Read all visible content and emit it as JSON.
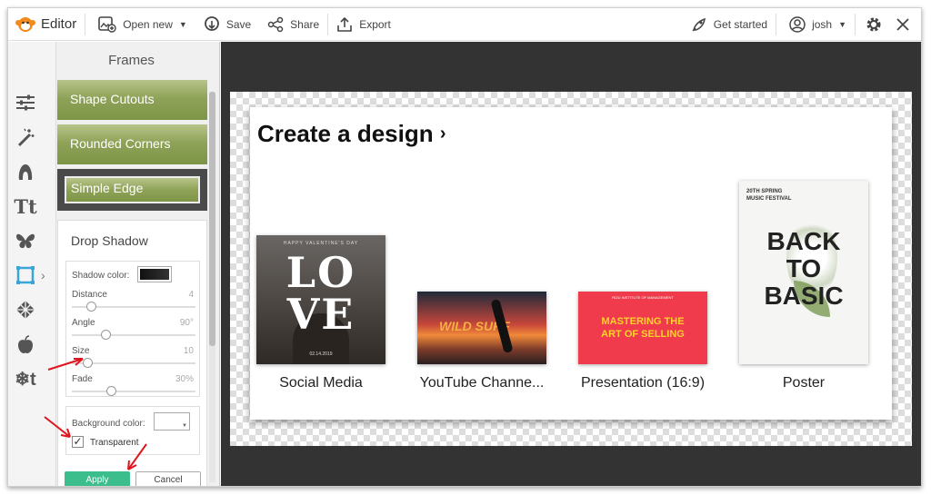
{
  "topbar": {
    "app_name": "Editor",
    "open_new": "Open new",
    "save": "Save",
    "share": "Share",
    "export": "Export",
    "get_started": "Get started",
    "user": "josh"
  },
  "rail": {
    "icons": [
      "adjustments-icon",
      "magic-wand-icon",
      "touch-up-icon",
      "text-icon",
      "butterfly-icon",
      "frame-icon",
      "texture-icon",
      "apple-icon",
      "seasonal-icon"
    ],
    "active": "frame-icon"
  },
  "panel": {
    "title": "Frames",
    "frames": [
      "Shape Cutouts",
      "Rounded Corners",
      "Simple Edge"
    ],
    "drop_shadow": {
      "title": "Drop Shadow",
      "shadow_color_label": "Shadow color:",
      "sliders": [
        {
          "label": "Distance",
          "value": "4"
        },
        {
          "label": "Angle",
          "value": "90°"
        },
        {
          "label": "Size",
          "value": "10"
        },
        {
          "label": "Fade",
          "value": "30%"
        }
      ],
      "background_color_label": "Background color:",
      "transparent_label": "Transparent",
      "transparent_checked": true,
      "apply": "Apply",
      "cancel": "Cancel"
    }
  },
  "canvas": {
    "heading": "Create a design",
    "designs": [
      {
        "label": "Social Media",
        "thumb_text": [
          "LOVE",
          "HAPPY VALENTINE'S DAY",
          "02.14.2019"
        ]
      },
      {
        "label": "YouTube Channe...",
        "thumb_text": [
          "WILD SURF"
        ]
      },
      {
        "label": "Presentation (16:9)",
        "thumb_text": [
          "MASTERING THE",
          "ART OF SELLING",
          "RIZU INSTITUTE OF MANAGEMENT"
        ]
      },
      {
        "label": "Poster",
        "thumb_text": [
          "20TH SPRING",
          "MUSIC FESTIVAL",
          "BACK",
          "TO",
          "BASIC"
        ]
      }
    ]
  },
  "colors": {
    "accent": "#3bbd8c",
    "workspace": "#333333",
    "arrow": "#e0141e",
    "logo": "#f28a1e",
    "active_icon": "#3aa6d8",
    "presentation_bg": "#ef3b4b",
    "presentation_text": "#ffd42a"
  }
}
